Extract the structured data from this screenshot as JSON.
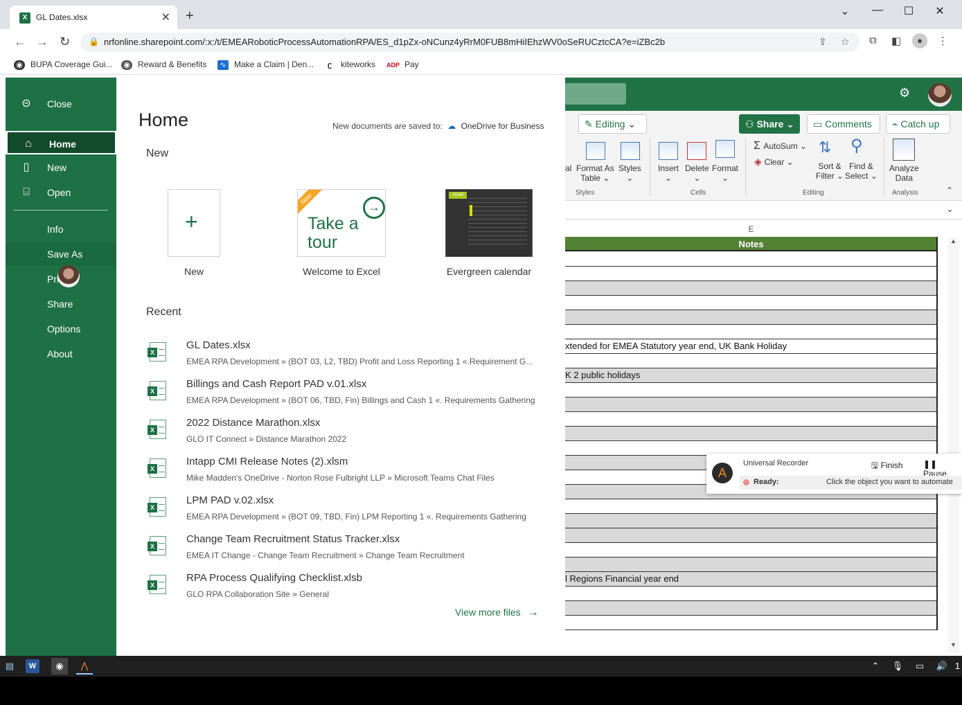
{
  "browser": {
    "tab_title": "GL Dates.xlsx",
    "tab_icon": "X",
    "url": "nrfonline.sharepoint.com/:x:/t/EMEARoboticProcessAutomationRPA/ES_d1pZx-oNCunz4yRrM0FUB8mHiIEhzWV0oSeRUCztcCA?e=iZBc2b",
    "bookmarks": [
      {
        "label": "BUPA Coverage Gui...",
        "icon": "globe-icon"
      },
      {
        "label": "Reward & Benefits",
        "icon": "globe-icon"
      },
      {
        "label": "Make a Claim | Den...",
        "icon": "pulse-icon"
      },
      {
        "label": "kiteworks",
        "icon": "kiteworks-icon"
      },
      {
        "label": "Pay",
        "icon": "adp-icon"
      }
    ]
  },
  "backstage": {
    "nav": [
      {
        "label": "Close",
        "icon": "back-icon"
      },
      {
        "label": "Home",
        "icon": "home-icon",
        "selected": true
      },
      {
        "label": "New",
        "icon": "new-doc-icon"
      },
      {
        "label": "Open",
        "icon": "folder-icon"
      },
      {
        "label": "Info"
      },
      {
        "label": "Save As"
      },
      {
        "label": "Pri"
      },
      {
        "label": "Share"
      },
      {
        "label": "Options"
      },
      {
        "label": "About"
      }
    ],
    "title": "Home",
    "saved_to_prefix": "New documents are saved to:",
    "saved_to": "OneDrive for Business",
    "new_heading": "New",
    "templates": [
      {
        "label": "New"
      },
      {
        "label": "Welcome to Excel",
        "badge": "New",
        "line1": "Take a",
        "line2": "tour"
      },
      {
        "label": "Evergreen calendar",
        "thumb_text": "YEAR"
      }
    ],
    "recent_heading": "Recent",
    "recent": [
      {
        "name": "GL Dates.xlsx",
        "path": "EMEA RPA Development » (BOT 03, L2, TBD) Profit and Loss Reporting 1 «.Requirement G..."
      },
      {
        "name": "Billings and Cash Report PAD v.01.xlsx",
        "path": "EMEA RPA Development » (BOT 06, TBD, Fin) Billings and Cash 1 «. Requirements Gathering"
      },
      {
        "name": "2022 Distance Marathon.xlsx",
        "path": "GLO IT Connect » Distance Marathon 2022"
      },
      {
        "name": "Intapp CMI Release Notes (2).xlsm",
        "path": "Mike Madden's OneDrive - Norton Rose Fulbright LLP » Microsoft Teams Chat Files"
      },
      {
        "name": "LPM PAD v.02.xlsx",
        "path": "EMEA RPA Development » (BOT 09, TBD, Fin) LPM Reporting 1 «. Requirements Gathering"
      },
      {
        "name": "Change Team Recruitment Status Tracker.xlsx",
        "path": "EMEA IT Change - Change Team Recruitment » Change Team Recruitment"
      },
      {
        "name": "RPA Process Qualifying Checklist.xlsb",
        "path": "GLO RPA Collaboration Site » General"
      }
    ],
    "view_more": "View more files"
  },
  "ribbon": {
    "editing": "Editing",
    "share": "Share",
    "comments": "Comments",
    "catch_up": "Catch up",
    "partial_label": "al",
    "format_as_table_1": "Format As",
    "format_as_table_2": "Table",
    "styles": "Styles",
    "styles_group": "Styles",
    "insert": "Insert",
    "delete": "Delete",
    "format": "Format",
    "cells_group": "Cells",
    "autosum": "AutoSum",
    "clear": "Clear",
    "sort_filter_1": "Sort &",
    "sort_filter_2": "Filter",
    "find_select_1": "Find &",
    "find_select_2": "Select",
    "editing_group": "Editing",
    "analyze_1": "Analyze",
    "analyze_2": "Data",
    "analysis_group": "Analysis"
  },
  "sheet": {
    "column": "E",
    "header": "Notes",
    "rows": [
      "",
      "",
      "",
      "",
      "",
      "",
      "xtended for EMEA Statutory year end, UK Bank Holiday",
      "",
      "K 2 public holidays",
      "",
      "",
      "",
      "",
      "",
      "",
      "",
      "",
      "",
      "",
      "",
      "",
      "",
      "l Regions Financial year end",
      "",
      "",
      ""
    ]
  },
  "recorder": {
    "title": "Universal Recorder",
    "finish": "Finish",
    "pause": "Pause",
    "status": "Ready:",
    "hint": "Click the object you want to automate"
  },
  "taskbar": {
    "clock_fragment": "1"
  }
}
